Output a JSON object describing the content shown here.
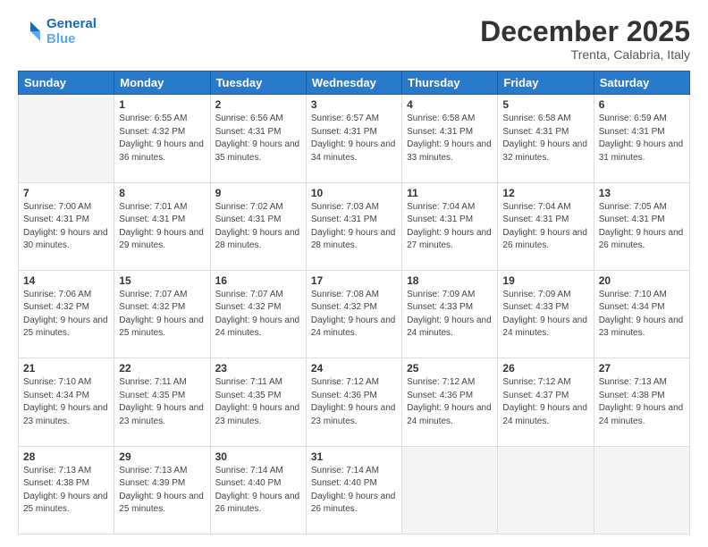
{
  "header": {
    "logo_line1": "General",
    "logo_line2": "Blue",
    "month": "December 2025",
    "location": "Trenta, Calabria, Italy"
  },
  "days_of_week": [
    "Sunday",
    "Monday",
    "Tuesday",
    "Wednesday",
    "Thursday",
    "Friday",
    "Saturday"
  ],
  "weeks": [
    [
      {
        "num": "",
        "empty": true
      },
      {
        "num": "1",
        "sunrise": "6:55 AM",
        "sunset": "4:32 PM",
        "daylight": "9 hours and 36 minutes."
      },
      {
        "num": "2",
        "sunrise": "6:56 AM",
        "sunset": "4:31 PM",
        "daylight": "9 hours and 35 minutes."
      },
      {
        "num": "3",
        "sunrise": "6:57 AM",
        "sunset": "4:31 PM",
        "daylight": "9 hours and 34 minutes."
      },
      {
        "num": "4",
        "sunrise": "6:58 AM",
        "sunset": "4:31 PM",
        "daylight": "9 hours and 33 minutes."
      },
      {
        "num": "5",
        "sunrise": "6:58 AM",
        "sunset": "4:31 PM",
        "daylight": "9 hours and 32 minutes."
      },
      {
        "num": "6",
        "sunrise": "6:59 AM",
        "sunset": "4:31 PM",
        "daylight": "9 hours and 31 minutes."
      }
    ],
    [
      {
        "num": "7",
        "sunrise": "7:00 AM",
        "sunset": "4:31 PM",
        "daylight": "9 hours and 30 minutes."
      },
      {
        "num": "8",
        "sunrise": "7:01 AM",
        "sunset": "4:31 PM",
        "daylight": "9 hours and 29 minutes."
      },
      {
        "num": "9",
        "sunrise": "7:02 AM",
        "sunset": "4:31 PM",
        "daylight": "9 hours and 28 minutes."
      },
      {
        "num": "10",
        "sunrise": "7:03 AM",
        "sunset": "4:31 PM",
        "daylight": "9 hours and 28 minutes."
      },
      {
        "num": "11",
        "sunrise": "7:04 AM",
        "sunset": "4:31 PM",
        "daylight": "9 hours and 27 minutes."
      },
      {
        "num": "12",
        "sunrise": "7:04 AM",
        "sunset": "4:31 PM",
        "daylight": "9 hours and 26 minutes."
      },
      {
        "num": "13",
        "sunrise": "7:05 AM",
        "sunset": "4:31 PM",
        "daylight": "9 hours and 26 minutes."
      }
    ],
    [
      {
        "num": "14",
        "sunrise": "7:06 AM",
        "sunset": "4:32 PM",
        "daylight": "9 hours and 25 minutes."
      },
      {
        "num": "15",
        "sunrise": "7:07 AM",
        "sunset": "4:32 PM",
        "daylight": "9 hours and 25 minutes."
      },
      {
        "num": "16",
        "sunrise": "7:07 AM",
        "sunset": "4:32 PM",
        "daylight": "9 hours and 24 minutes."
      },
      {
        "num": "17",
        "sunrise": "7:08 AM",
        "sunset": "4:32 PM",
        "daylight": "9 hours and 24 minutes."
      },
      {
        "num": "18",
        "sunrise": "7:09 AM",
        "sunset": "4:33 PM",
        "daylight": "9 hours and 24 minutes."
      },
      {
        "num": "19",
        "sunrise": "7:09 AM",
        "sunset": "4:33 PM",
        "daylight": "9 hours and 24 minutes."
      },
      {
        "num": "20",
        "sunrise": "7:10 AM",
        "sunset": "4:34 PM",
        "daylight": "9 hours and 23 minutes."
      }
    ],
    [
      {
        "num": "21",
        "sunrise": "7:10 AM",
        "sunset": "4:34 PM",
        "daylight": "9 hours and 23 minutes."
      },
      {
        "num": "22",
        "sunrise": "7:11 AM",
        "sunset": "4:35 PM",
        "daylight": "9 hours and 23 minutes."
      },
      {
        "num": "23",
        "sunrise": "7:11 AM",
        "sunset": "4:35 PM",
        "daylight": "9 hours and 23 minutes."
      },
      {
        "num": "24",
        "sunrise": "7:12 AM",
        "sunset": "4:36 PM",
        "daylight": "9 hours and 23 minutes."
      },
      {
        "num": "25",
        "sunrise": "7:12 AM",
        "sunset": "4:36 PM",
        "daylight": "9 hours and 24 minutes."
      },
      {
        "num": "26",
        "sunrise": "7:12 AM",
        "sunset": "4:37 PM",
        "daylight": "9 hours and 24 minutes."
      },
      {
        "num": "27",
        "sunrise": "7:13 AM",
        "sunset": "4:38 PM",
        "daylight": "9 hours and 24 minutes."
      }
    ],
    [
      {
        "num": "28",
        "sunrise": "7:13 AM",
        "sunset": "4:38 PM",
        "daylight": "9 hours and 25 minutes."
      },
      {
        "num": "29",
        "sunrise": "7:13 AM",
        "sunset": "4:39 PM",
        "daylight": "9 hours and 25 minutes."
      },
      {
        "num": "30",
        "sunrise": "7:14 AM",
        "sunset": "4:40 PM",
        "daylight": "9 hours and 26 minutes."
      },
      {
        "num": "31",
        "sunrise": "7:14 AM",
        "sunset": "4:40 PM",
        "daylight": "9 hours and 26 minutes."
      },
      {
        "num": "",
        "empty": true
      },
      {
        "num": "",
        "empty": true
      },
      {
        "num": "",
        "empty": true
      }
    ]
  ],
  "labels": {
    "sunrise_prefix": "Sunrise: ",
    "sunset_prefix": "Sunset: ",
    "daylight_prefix": "Daylight: "
  }
}
